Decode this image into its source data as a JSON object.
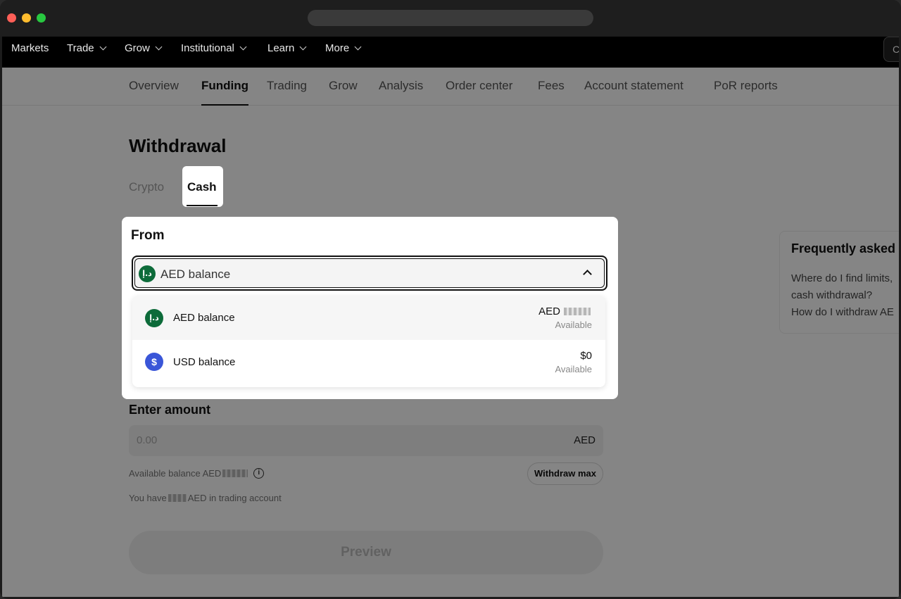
{
  "nav": {
    "items": [
      {
        "label": "Markets",
        "dropdown": false
      },
      {
        "label": "Trade",
        "dropdown": true
      },
      {
        "label": "Grow",
        "dropdown": true
      },
      {
        "label": "Institutional",
        "dropdown": true
      },
      {
        "label": "Learn",
        "dropdown": true
      },
      {
        "label": "More",
        "dropdown": true
      }
    ],
    "search_glyph": "C"
  },
  "subnav": {
    "tabs": [
      "Overview",
      "Funding",
      "Trading",
      "Grow",
      "Analysis",
      "Order center",
      "Fees",
      "Account statement",
      "PoR reports"
    ],
    "active": "Funding"
  },
  "page": {
    "title": "Withdrawal",
    "tabs": {
      "crypto": "Crypto",
      "cash": "Cash"
    }
  },
  "from": {
    "label": "From",
    "selected": "AED balance",
    "aed_glyph": "د.إ",
    "usd_glyph": "$",
    "options": [
      {
        "name": "AED balance",
        "amount_prefix": "AED",
        "amount_masked": true,
        "sub": "Available"
      },
      {
        "name": "USD balance",
        "amount": "$0",
        "sub": "Available"
      }
    ]
  },
  "amount": {
    "label": "Enter amount",
    "placeholder": "0.00",
    "unit": "AED",
    "available_prefix": "Available balance AED",
    "info_glyph": "i",
    "withdraw_max": "Withdraw max",
    "trading_prefix": "You have",
    "trading_suffix": "AED in trading account"
  },
  "preview_label": "Preview",
  "faq": {
    "title": "Frequently asked",
    "questions": [
      "Where do I find limits,",
      "cash withdrawal?",
      "How do I withdraw AE"
    ]
  },
  "colors": {
    "aed_icon": "#0d6b3a",
    "usd_icon": "#3a56d8",
    "overlay": "rgba(0,0,0,0.48)"
  }
}
